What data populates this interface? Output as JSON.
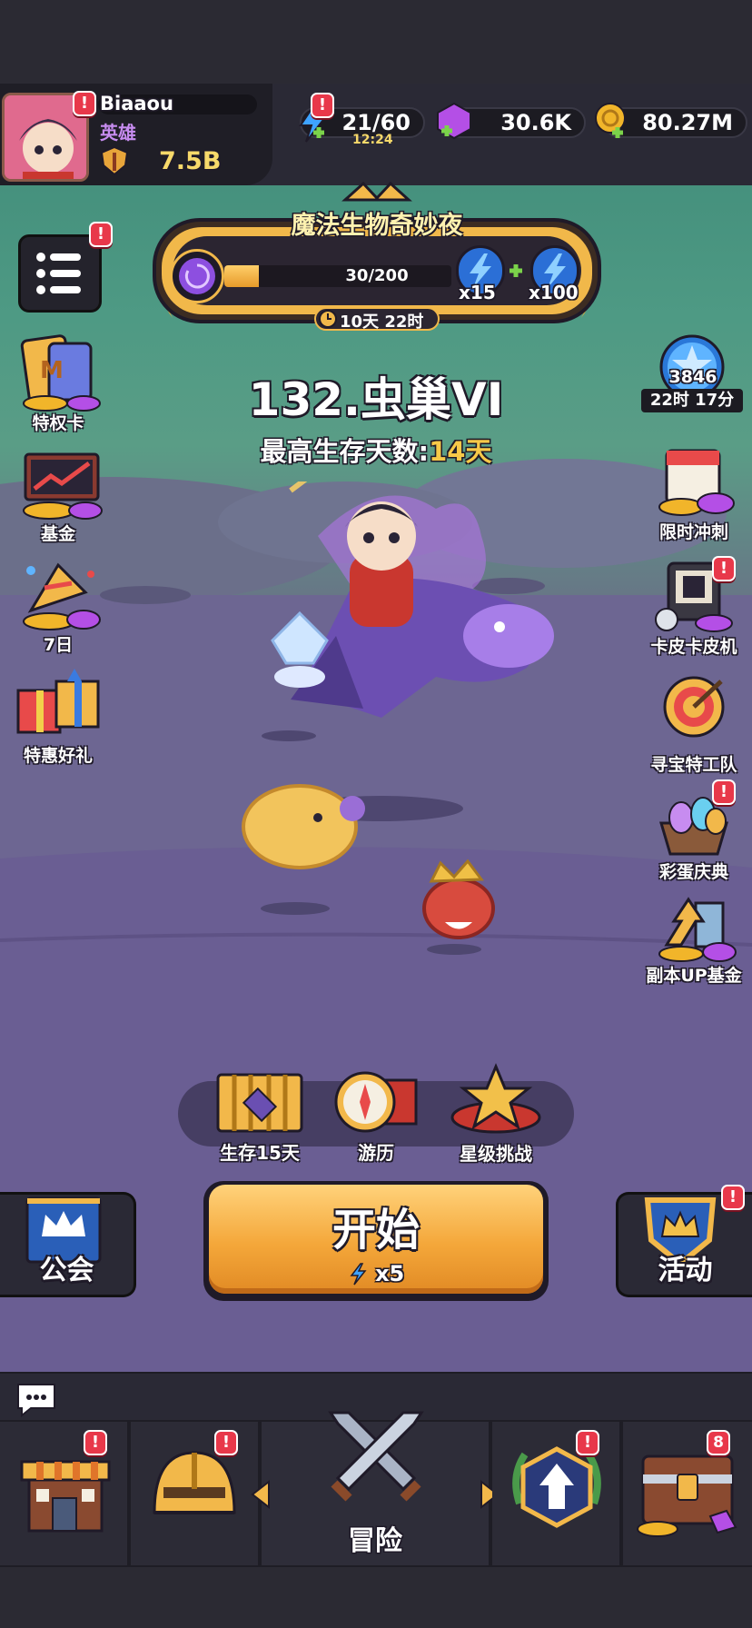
{
  "player": {
    "name": "Biaaou",
    "title": "英雄",
    "power": "7.5B"
  },
  "resources": {
    "energy": "21/60",
    "energy_timer": "12:24",
    "gems": "30.6K",
    "gold": "80.27M"
  },
  "event": {
    "title": "魔法生物奇妙夜",
    "progress": "30/200",
    "progress_fraction": 0.15,
    "reward1": "x15",
    "reward2": "x100",
    "timer": "10天 22时"
  },
  "stage": {
    "name": "132.虫巢VI",
    "best_prefix": "最高生存天数:",
    "best_value": "14天"
  },
  "star_badge": {
    "count": "3846",
    "timer": "22时 17分"
  },
  "left_menu": [
    {
      "label": "特权卡",
      "icon": "privilege-card-icon"
    },
    {
      "label": "基金",
      "icon": "fund-chart-icon"
    },
    {
      "label": "7日",
      "icon": "seven-day-party-icon"
    },
    {
      "label": "特惠好礼",
      "icon": "gift-box-icon"
    }
  ],
  "right_menu": [
    {
      "label": "限时冲刺",
      "icon": "calendar-icon"
    },
    {
      "label": "卡皮卡皮机",
      "icon": "slot-machine-icon"
    },
    {
      "label": "寻宝特工队",
      "icon": "target-icon"
    },
    {
      "label": "彩蛋庆典",
      "icon": "egg-basket-icon"
    },
    {
      "label": "副本UP基金",
      "icon": "arrow-up-fund-icon"
    }
  ],
  "modes": [
    {
      "label": "生存15天",
      "icon": "gate-icon"
    },
    {
      "label": "游历",
      "icon": "compass-icon"
    },
    {
      "label": "星级挑战",
      "icon": "star-crown-icon"
    }
  ],
  "start_button": {
    "label": "开始",
    "cost": "x5"
  },
  "guild_button": {
    "label": "公会"
  },
  "activity_button": {
    "label": "活动"
  },
  "bottom_nav": {
    "center_label": "冒险",
    "chest_badge": "8"
  },
  "colors": {
    "accent": "#f7a93a",
    "badge": "#e8384a",
    "energy": "#3ea3ff",
    "gem": "#b44fe6",
    "gold": "#f1b52a"
  }
}
